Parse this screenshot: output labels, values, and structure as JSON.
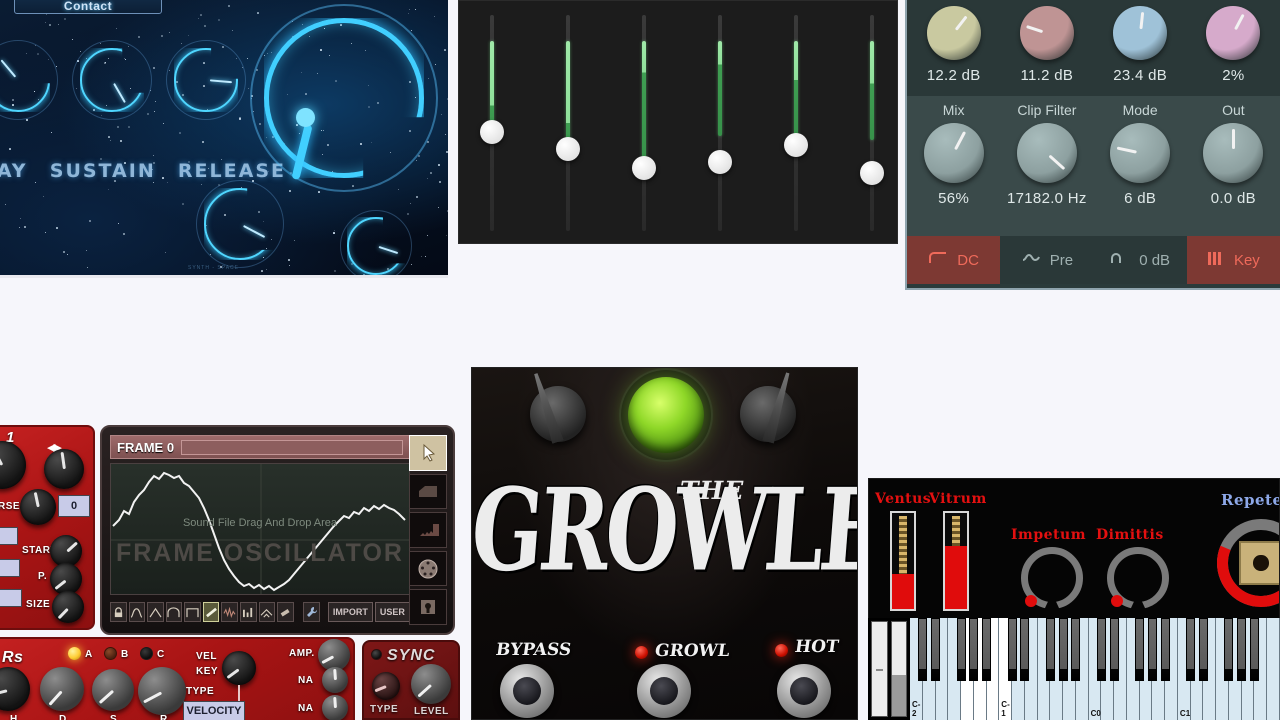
{
  "background_color": "#f6f6fb",
  "space_synth": {
    "preset_label": "Contact",
    "adsr_labels": [
      "ECAY",
      "SUSTAIN",
      "RELEASE"
    ],
    "footer_text": "SYNTH - SPACE",
    "accent_color": "#41cfff",
    "knobs": [
      {
        "name": "attack",
        "value_deg": -40
      },
      {
        "name": "decay",
        "value_deg": 150
      },
      {
        "name": "sustain",
        "value_deg": 95
      },
      {
        "name": "release",
        "value_deg": 125
      },
      {
        "name": "lfo-rate",
        "value_deg": 118
      },
      {
        "name": "lfo-depth",
        "value_deg": 108
      }
    ],
    "big_knob": {
      "name": "resonance",
      "value_deg": 128
    }
  },
  "fader_rack": {
    "background_color": "#1c1c1c",
    "meter_color": "#76d684",
    "faders": [
      {
        "name": "band-1",
        "thumb_pct": 54,
        "meter_top_pct": 12,
        "meter_bottom_pct": 54,
        "bright_pct": 42
      },
      {
        "name": "band-2",
        "thumb_pct": 62,
        "meter_top_pct": 12,
        "meter_bottom_pct": 62,
        "bright_pct": 50
      },
      {
        "name": "band-3",
        "thumb_pct": 71,
        "meter_top_pct": 12,
        "meter_bottom_pct": 71,
        "bright_pct": 27
      },
      {
        "name": "band-4",
        "thumb_pct": 68,
        "meter_top_pct": 12,
        "meter_bottom_pct": 56,
        "bright_pct": 23
      },
      {
        "name": "band-5",
        "thumb_pct": 60,
        "meter_top_pct": 12,
        "meter_bottom_pct": 56,
        "bright_pct": 30
      },
      {
        "name": "band-6",
        "thumb_pct": 73,
        "meter_top_pct": 12,
        "meter_bottom_pct": 58,
        "bright_pct": 32
      }
    ]
  },
  "saturator": {
    "background_color": "#2b3b3b",
    "top_knobs": [
      {
        "name": "drive",
        "value": "12.2 dB",
        "color": "#c9c9a0",
        "angle": 38
      },
      {
        "name": "bias",
        "value": "11.2 dB",
        "color": "#bf9494",
        "angle": -72
      },
      {
        "name": "tone",
        "value": "23.4 dB",
        "color": "#9fc2d8",
        "angle": 6
      },
      {
        "name": "amount",
        "value": "2%",
        "color": "#d6aacb",
        "angle": 28
      }
    ],
    "bottom_knobs": [
      {
        "name": "mix",
        "label": "Mix",
        "value": "56%",
        "angle": 28
      },
      {
        "name": "clip-filter",
        "label": "Clip Filter",
        "value": "17182.0 Hz",
        "angle": 132
      },
      {
        "name": "mode",
        "label": "Mode",
        "value": "6 dB",
        "angle": -78
      },
      {
        "name": "out",
        "label": "Out",
        "value": "0.0 dB",
        "angle": 0
      }
    ],
    "buttons": [
      {
        "name": "dc-filter",
        "label": "DC",
        "icon": "step-curve-icon",
        "active": true
      },
      {
        "name": "pre-mode",
        "label": "Pre",
        "icon": "wave-curve-icon",
        "active": false
      },
      {
        "name": "gain-0db",
        "label": "0 dB",
        "icon": "bandpass-curve-icon",
        "active": false
      },
      {
        "name": "key-input",
        "label": "Key",
        "icon": "keyboard-icon",
        "active": true
      }
    ],
    "active_color": "#ef6a5a"
  },
  "frame_oscillator": {
    "frame_label": "FRAME 0",
    "drop_hint": "Sound File Drag And Drop Area",
    "watermark": "FRAME OSCILLATOR",
    "import_label": "IMPORT",
    "user_label": "USER",
    "tool_icons": [
      "lock-icon",
      "sine-wave-icon",
      "triangle-wave-icon",
      "arch-wave-icon",
      "square-wave-icon",
      "draw-line-icon",
      "noise-icon",
      "harmonics-icon",
      "smooth-icon",
      "eraser-icon"
    ],
    "selected_tool": "draw-line-icon",
    "wrench_icon": "wrench-icon",
    "rail_icons": [
      "cursor-tool-icon",
      "ramp-tool-icon",
      "saw-tool-icon",
      "midi-port-icon",
      "output-icon"
    ],
    "selected_rail": "cursor-tool-icon"
  },
  "red_synth": {
    "panel_number": "1",
    "labels_left": [
      "RSE",
      "START",
      "P.",
      "SIZE"
    ],
    "value_box": "0",
    "env_title": "Rs",
    "env_knobs": [
      "H",
      "D",
      "S",
      "R"
    ],
    "leds": [
      {
        "name": "led-a",
        "label": "A",
        "on": true,
        "color": "#ffcc33"
      },
      {
        "name": "led-b",
        "label": "B",
        "on": false,
        "color": "#6a2a18"
      },
      {
        "name": "led-c",
        "label": "C",
        "on": false,
        "color": "#1a1a1a"
      }
    ],
    "vel_key_label": [
      "VEL",
      "KEY"
    ],
    "type_label": "TYPE",
    "type_value": "VELOCITY",
    "right_labels": [
      "AMP.",
      "NA",
      "NA"
    ],
    "sync": {
      "title": "SYNC",
      "knobs": [
        "TYPE",
        "LEVEL"
      ]
    }
  },
  "growler": {
    "brand_the": "THE",
    "brand_main": "GROWLER",
    "footswitches": [
      {
        "name": "bypass-switch",
        "label": "BYPASS",
        "led": false
      },
      {
        "name": "growl-switch",
        "label": "GROWL",
        "led": true
      },
      {
        "name": "hot-switch",
        "label": "HOT",
        "led": true
      }
    ],
    "jewel_color": "#8fd828",
    "knobs": [
      {
        "name": "level-knob",
        "angle": -18
      },
      {
        "name": "gain-knob",
        "angle": 18
      }
    ]
  },
  "rompler": {
    "background_color": "#050505",
    "sliders": [
      {
        "name": "ventus",
        "label": "Ventus",
        "fill_pct": 36
      },
      {
        "name": "vitrum",
        "label": "Vitrum",
        "fill_pct": 66
      }
    ],
    "knobs": [
      {
        "name": "impetum",
        "label": "Impetum",
        "angle": 208
      },
      {
        "name": "dimittis",
        "label": "Dimittis",
        "angle": 208
      }
    ],
    "big_knob": {
      "name": "repetendum",
      "label": "Repeten",
      "angle": 200
    },
    "keyboard": {
      "octave_labels": [
        "C-2",
        "C-1",
        "C0",
        "C1"
      ],
      "white_key_count": 29,
      "highlighted_keys": [
        4,
        5,
        6,
        7
      ],
      "wheels": [
        "pitch-wheel",
        "mod-wheel"
      ]
    }
  }
}
